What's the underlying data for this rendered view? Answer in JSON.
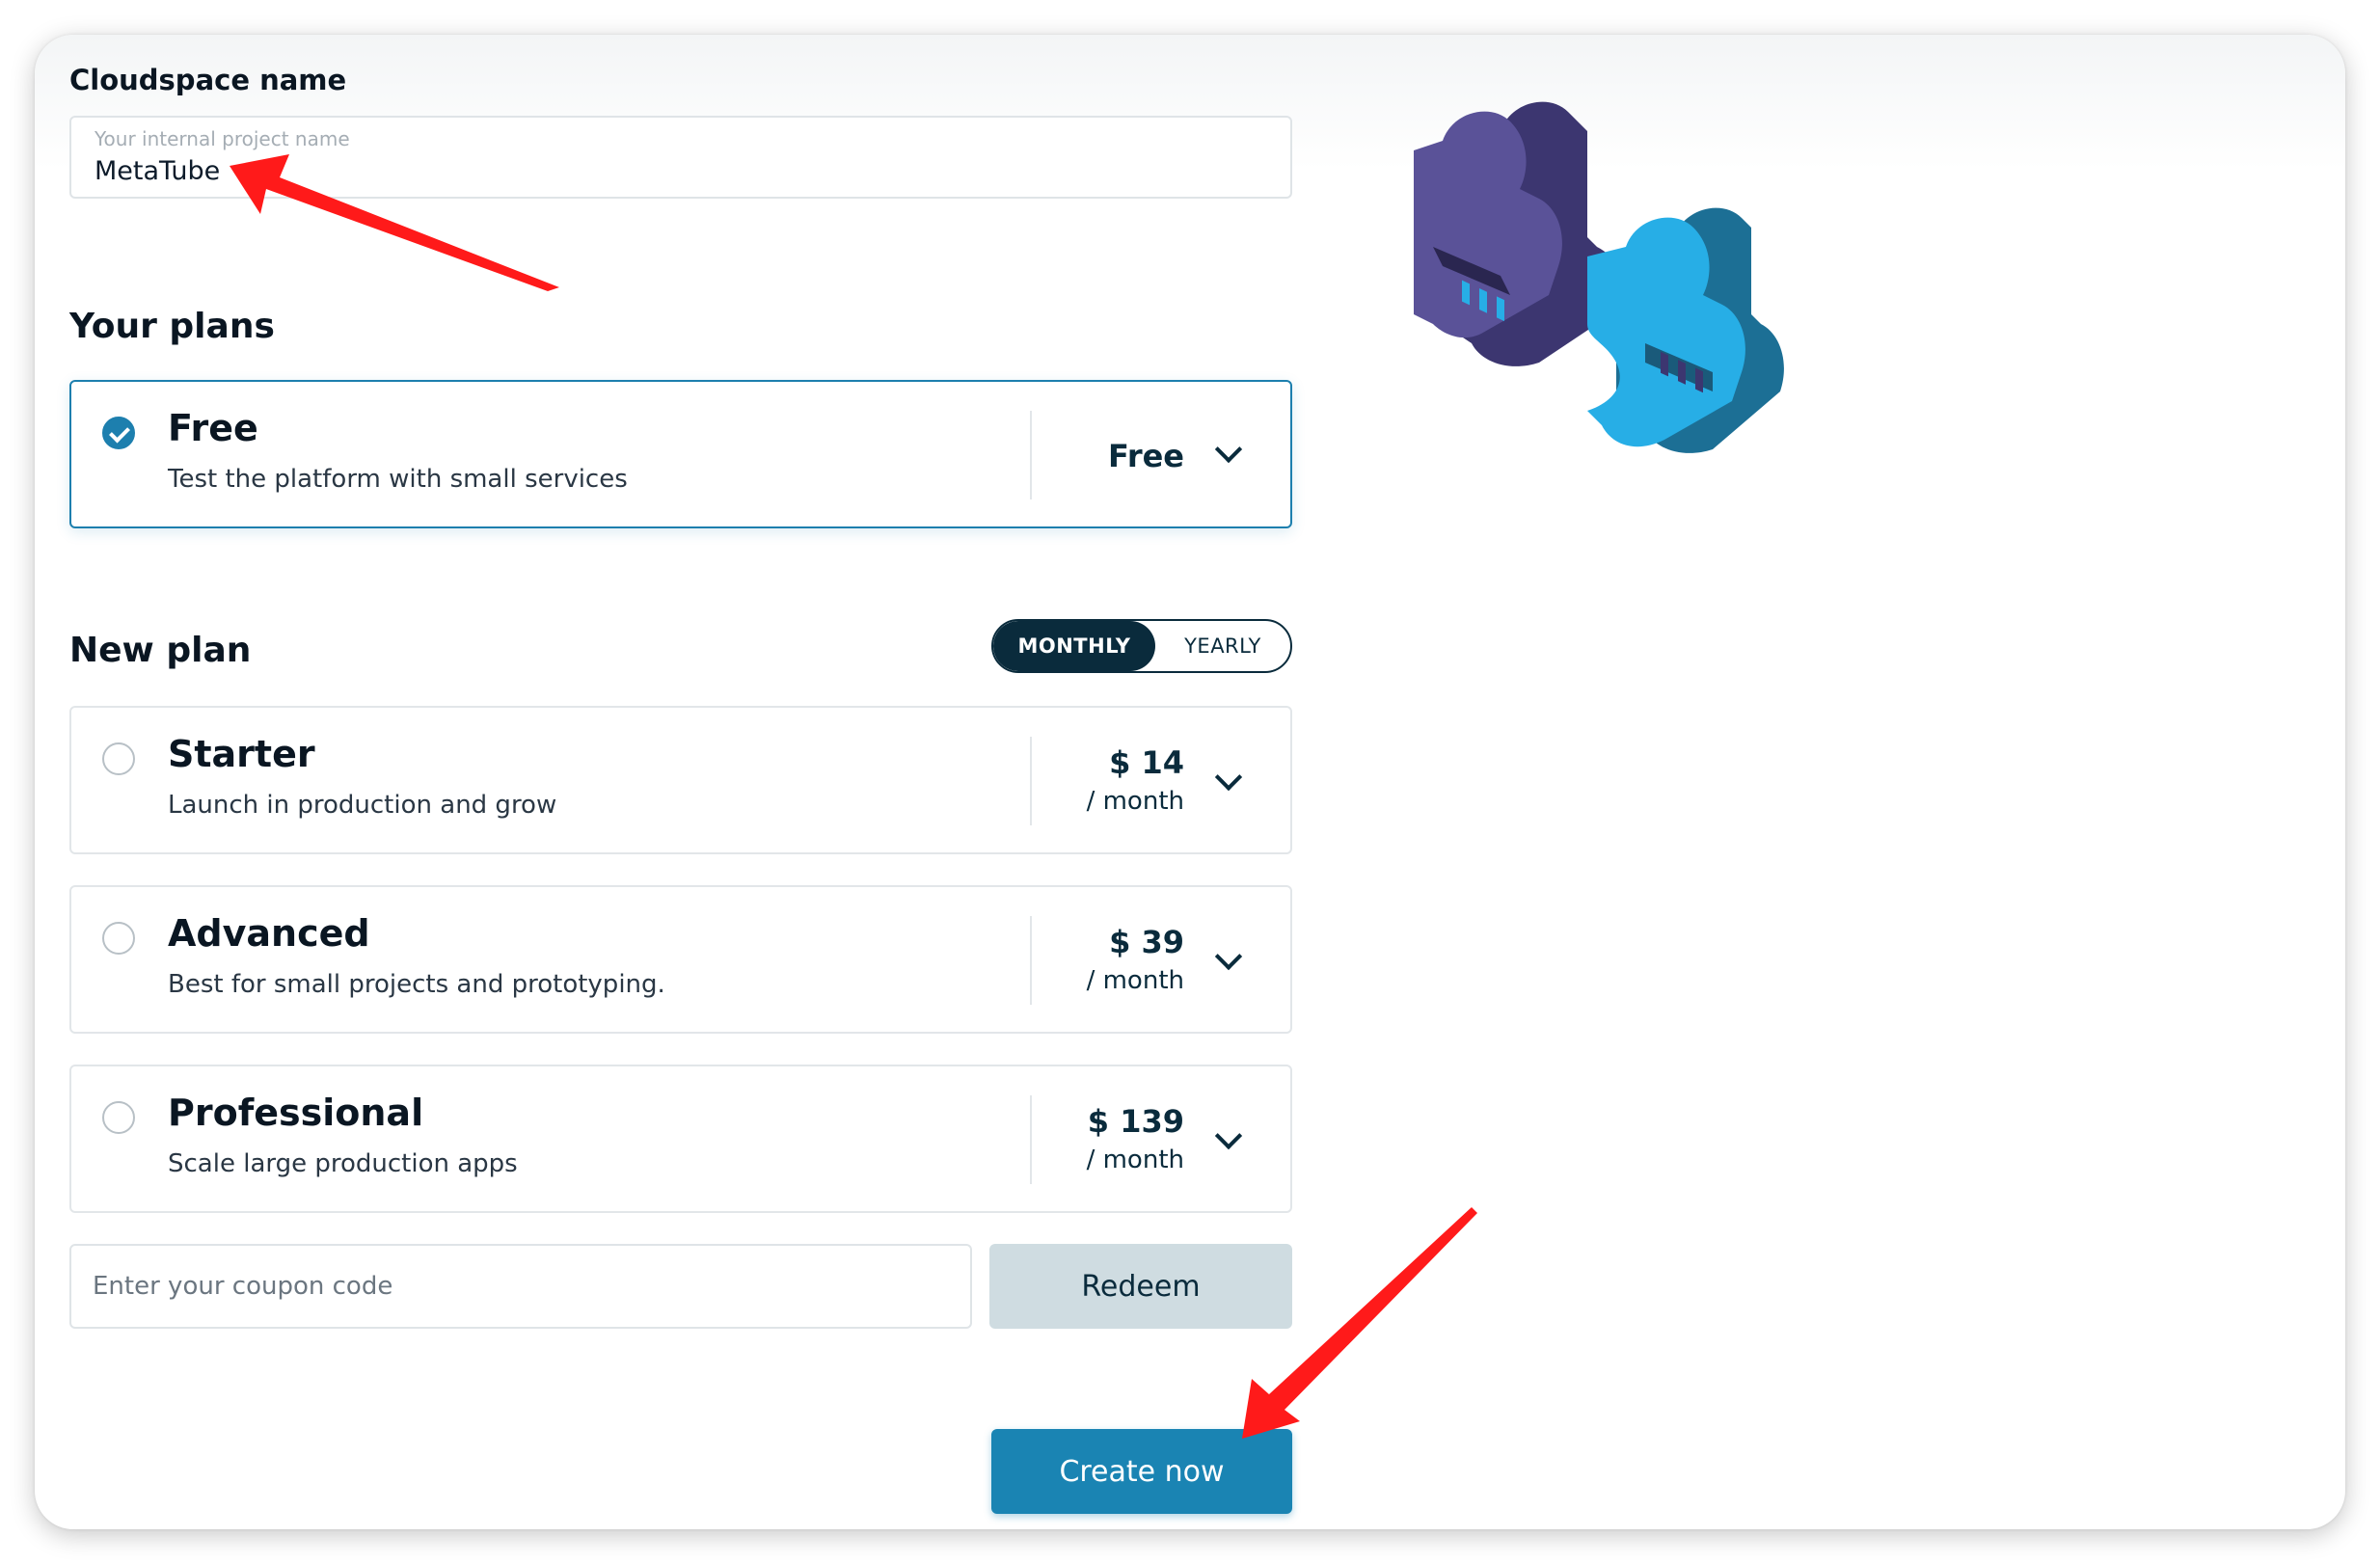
{
  "cloudspace": {
    "title": "Cloudspace name",
    "placeholder": "Your internal project name",
    "value": "MetaTube"
  },
  "your_plans": {
    "title": "Your plans",
    "current": {
      "name": "Free",
      "description": "Test the platform with small services",
      "price_label": "Free",
      "selected": true
    }
  },
  "new_plan": {
    "title": "New plan",
    "billing_toggle": {
      "options": [
        "MONTHLY",
        "YEARLY"
      ],
      "active": "MONTHLY"
    },
    "plans": [
      {
        "name": "Starter",
        "description": "Launch in production and grow",
        "price": "$ 14",
        "period": "/ month"
      },
      {
        "name": "Advanced",
        "description": "Best for small projects and prototyping.",
        "price": "$ 39",
        "period": "/ month"
      },
      {
        "name": "Professional",
        "description": "Scale large production apps",
        "price": "$ 139",
        "period": "/ month"
      }
    ]
  },
  "coupon": {
    "placeholder": "Enter your coupon code",
    "redeem_label": "Redeem"
  },
  "actions": {
    "create_label": "Create now"
  },
  "colors": {
    "accent": "#1a84b3",
    "dark": "#0a2b3c",
    "annotation": "#ff1a1a",
    "puzzle_purple": "#5a5298",
    "puzzle_blue": "#27aee6"
  }
}
